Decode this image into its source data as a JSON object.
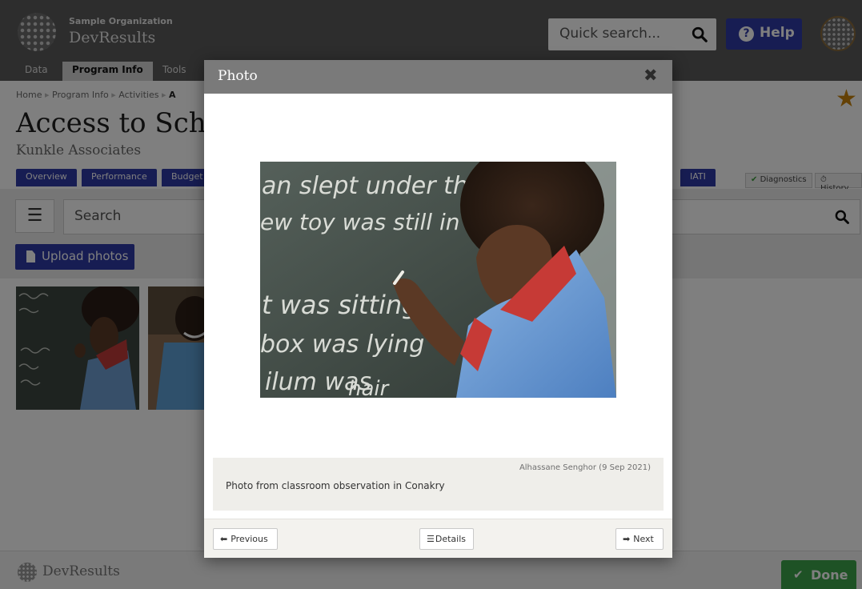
{
  "header": {
    "org_name": "Sample Organization",
    "app_name": "DevResults",
    "quick_search_placeholder": "Quick search...",
    "help_label": "Help",
    "help_icon": "question-circle-icon"
  },
  "main_tabs": [
    {
      "label": "Data"
    },
    {
      "label": "Program Info",
      "active": true
    },
    {
      "label": "Tools"
    }
  ],
  "breadcrumb": [
    "Home",
    "Program Info",
    "Activities",
    "A"
  ],
  "page": {
    "title": "Access to Schoo",
    "subtitle": "Kunkle Associates"
  },
  "sub_tabs": [
    {
      "label": "Overview"
    },
    {
      "label": "Performance"
    },
    {
      "label": "Budget"
    },
    {
      "label": "IATI"
    }
  ],
  "status_links": {
    "diagnostics": "Diagnostics",
    "history": "History"
  },
  "search": {
    "placeholder": "Search",
    "menu_icon": "☰"
  },
  "upload_label": "Upload photos",
  "footer": {
    "app_name": "DevResults",
    "done_label": "Done"
  },
  "modal": {
    "title": "Photo",
    "close_glyph": "✖",
    "photo": {
      "chalk_lines": [
        "an slept under the stars",
        "ew toy was still in the",
        "t was sitting",
        "box was lying",
        "ilum was",
        "hair"
      ]
    },
    "credit": "Alhassane Senghor (9 Sep 2021)",
    "caption": "Photo from classroom observation in Conakry",
    "buttons": {
      "previous": "Previous",
      "details": "Details",
      "next": "Next"
    }
  },
  "colors": {
    "brand_blue": "#2f3aa7",
    "done_green": "#3da54a",
    "star_orange": "#c8820a",
    "modal_header": "#7a7a7a"
  }
}
